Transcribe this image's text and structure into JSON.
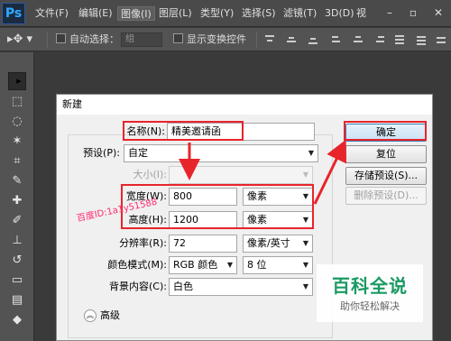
{
  "app": {
    "logo": "Ps"
  },
  "menu": [
    "文件(F)",
    "编辑(E)",
    "图像(I)",
    "图层(L)",
    "类型(Y)",
    "选择(S)",
    "滤镜(T)",
    "3D(D)",
    "视"
  ],
  "window_controls": [
    "–",
    "▫",
    "✕"
  ],
  "options_bar": {
    "auto_select_label": "自动选择：",
    "auto_select_value": "组",
    "show_transform_label": "显示变换控件"
  },
  "tools": [
    "move-tool",
    "marquee-tool",
    "lasso-tool",
    "magic-wand-tool",
    "crop-tool",
    "eyedropper-tool",
    "healing-brush-tool",
    "brush-tool",
    "clone-stamp-tool",
    "history-brush-tool",
    "eraser-tool",
    "gradient-tool",
    "blur-tool"
  ],
  "dialog": {
    "title": "新建",
    "name": {
      "label": "名称(N):",
      "value": "精美邀请函"
    },
    "preset": {
      "label": "预设(P):",
      "value": "自定"
    },
    "size": {
      "label": "大小(I):",
      "value": ""
    },
    "width": {
      "label": "宽度(W):",
      "value": "800",
      "unit": "像素"
    },
    "height": {
      "label": "高度(H):",
      "value": "1200",
      "unit": "像素"
    },
    "resolution": {
      "label": "分辨率(R):",
      "value": "72",
      "unit": "像素/英寸"
    },
    "color_mode": {
      "label": "颜色模式(M):",
      "value": "RGB 颜色",
      "depth": "8 位"
    },
    "background": {
      "label": "背景内容(C):",
      "value": "白色"
    },
    "advanced_label": "高级",
    "buttons": {
      "ok": "确定",
      "reset": "复位",
      "save_preset": "存储预设(S)...",
      "delete_preset": "删除预设(D)..."
    }
  },
  "watermark": "百度ID:1a1y51588",
  "stamp": {
    "title": "百科全说",
    "subtitle": "助你轻松解决"
  },
  "colors": {
    "annotation_red": "#e8242b",
    "stamp_green": "#1a9a62",
    "ps_blue": "#31a8ff"
  }
}
